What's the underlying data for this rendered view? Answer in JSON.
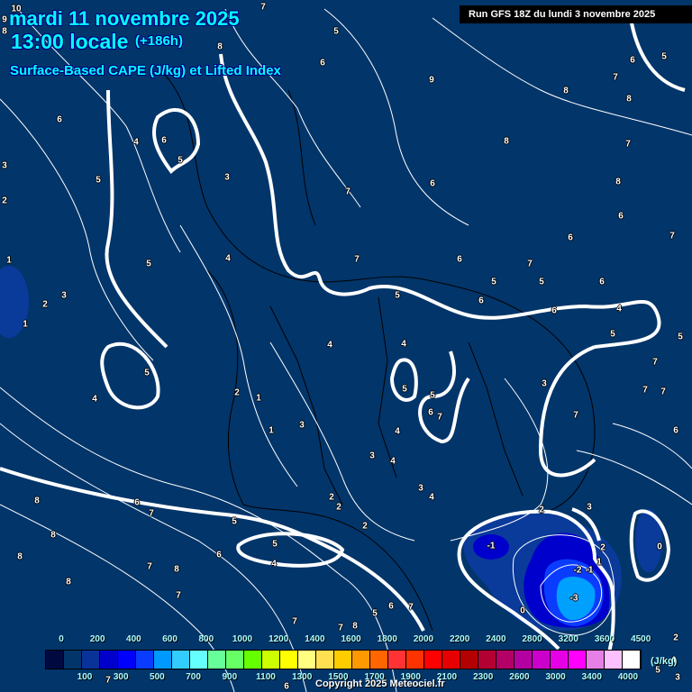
{
  "header": {
    "date": "mardi 11 novembre 2025",
    "time": "13:00 locale",
    "lead": "(+186h)",
    "parameter": "Surface-Based CAPE (J/kg) et Lifted Index",
    "run": "Run GFS 18Z du lundi 3 novembre 2025"
  },
  "colors": {
    "background": "#02356a",
    "contour": "#ffffff",
    "cape_blue_1": "#0a3a9a",
    "cape_blue_2": "#0000cc",
    "cape_blue_3": "#0000ff",
    "cape_blue_4": "#0a3cff",
    "cape_light": "#00a0ff",
    "title": "#00ffff"
  },
  "lifted_index_labels": [
    "7",
    "5",
    "8",
    "6",
    "5",
    "6",
    "9",
    "8",
    "7",
    "8",
    "6",
    "6",
    "4",
    "5",
    "8",
    "7",
    "3",
    "5",
    "3",
    "7",
    "6",
    "8",
    "2",
    "6",
    "6",
    "7",
    "1",
    "5",
    "4",
    "7",
    "6",
    "7",
    "3",
    "2",
    "5",
    "5",
    "6",
    "5",
    "6",
    "6",
    "4",
    "1",
    "4",
    "4",
    "5",
    "5",
    "5",
    "4",
    "2",
    "1",
    "5",
    "5",
    "3",
    "7",
    "7",
    "7",
    "6",
    "7",
    "3",
    "1",
    "4",
    "7",
    "6",
    "3",
    "4",
    "3",
    "4",
    "2",
    "2",
    "2",
    "8",
    "6",
    "7",
    "5",
    "2",
    "3",
    "8",
    "5",
    "6",
    "7",
    "8",
    "8",
    "-1",
    "0",
    "2",
    "4",
    "-2",
    "-1",
    "1",
    "8",
    "-3",
    "0",
    "7",
    "6",
    "7",
    "5",
    "7",
    "7",
    "8",
    "2",
    "4",
    "5",
    "3",
    "6",
    "7",
    "10",
    "9",
    "8"
  ],
  "legend": {
    "swatches": [
      "#000a40",
      "#02356a",
      "#0a3399",
      "#0000cc",
      "#0000ff",
      "#0a3cff",
      "#0099ff",
      "#33ccff",
      "#66ffff",
      "#66ff99",
      "#66ff66",
      "#66ff00",
      "#ccff00",
      "#ffff00",
      "#ffff80",
      "#ffe050",
      "#ffcc00",
      "#ff9900",
      "#ff6600",
      "#ff3333",
      "#ff3300",
      "#ff0000",
      "#e60000",
      "#b30000",
      "#b30033",
      "#b30066",
      "#b300a0",
      "#cc00cc",
      "#e600e6",
      "#ff00ff",
      "#e680e6",
      "#ffc0ff",
      "#ffffff"
    ],
    "top_ticks": [
      "0",
      "200",
      "400",
      "600",
      "800",
      "1000",
      "1200",
      "1400",
      "1600",
      "1800",
      "2000",
      "2200",
      "2400",
      "2800",
      "3200",
      "3600",
      "4500"
    ],
    "bottom_ticks": [
      "100",
      "300",
      "500",
      "700",
      "900",
      "1100",
      "1300",
      "1500",
      "1700",
      "1900",
      "2100",
      "2300",
      "2600",
      "3000",
      "3400",
      "4000"
    ],
    "unit": "(J/kg)"
  },
  "copyright": "Copyright 2025 Meteociel.fr"
}
